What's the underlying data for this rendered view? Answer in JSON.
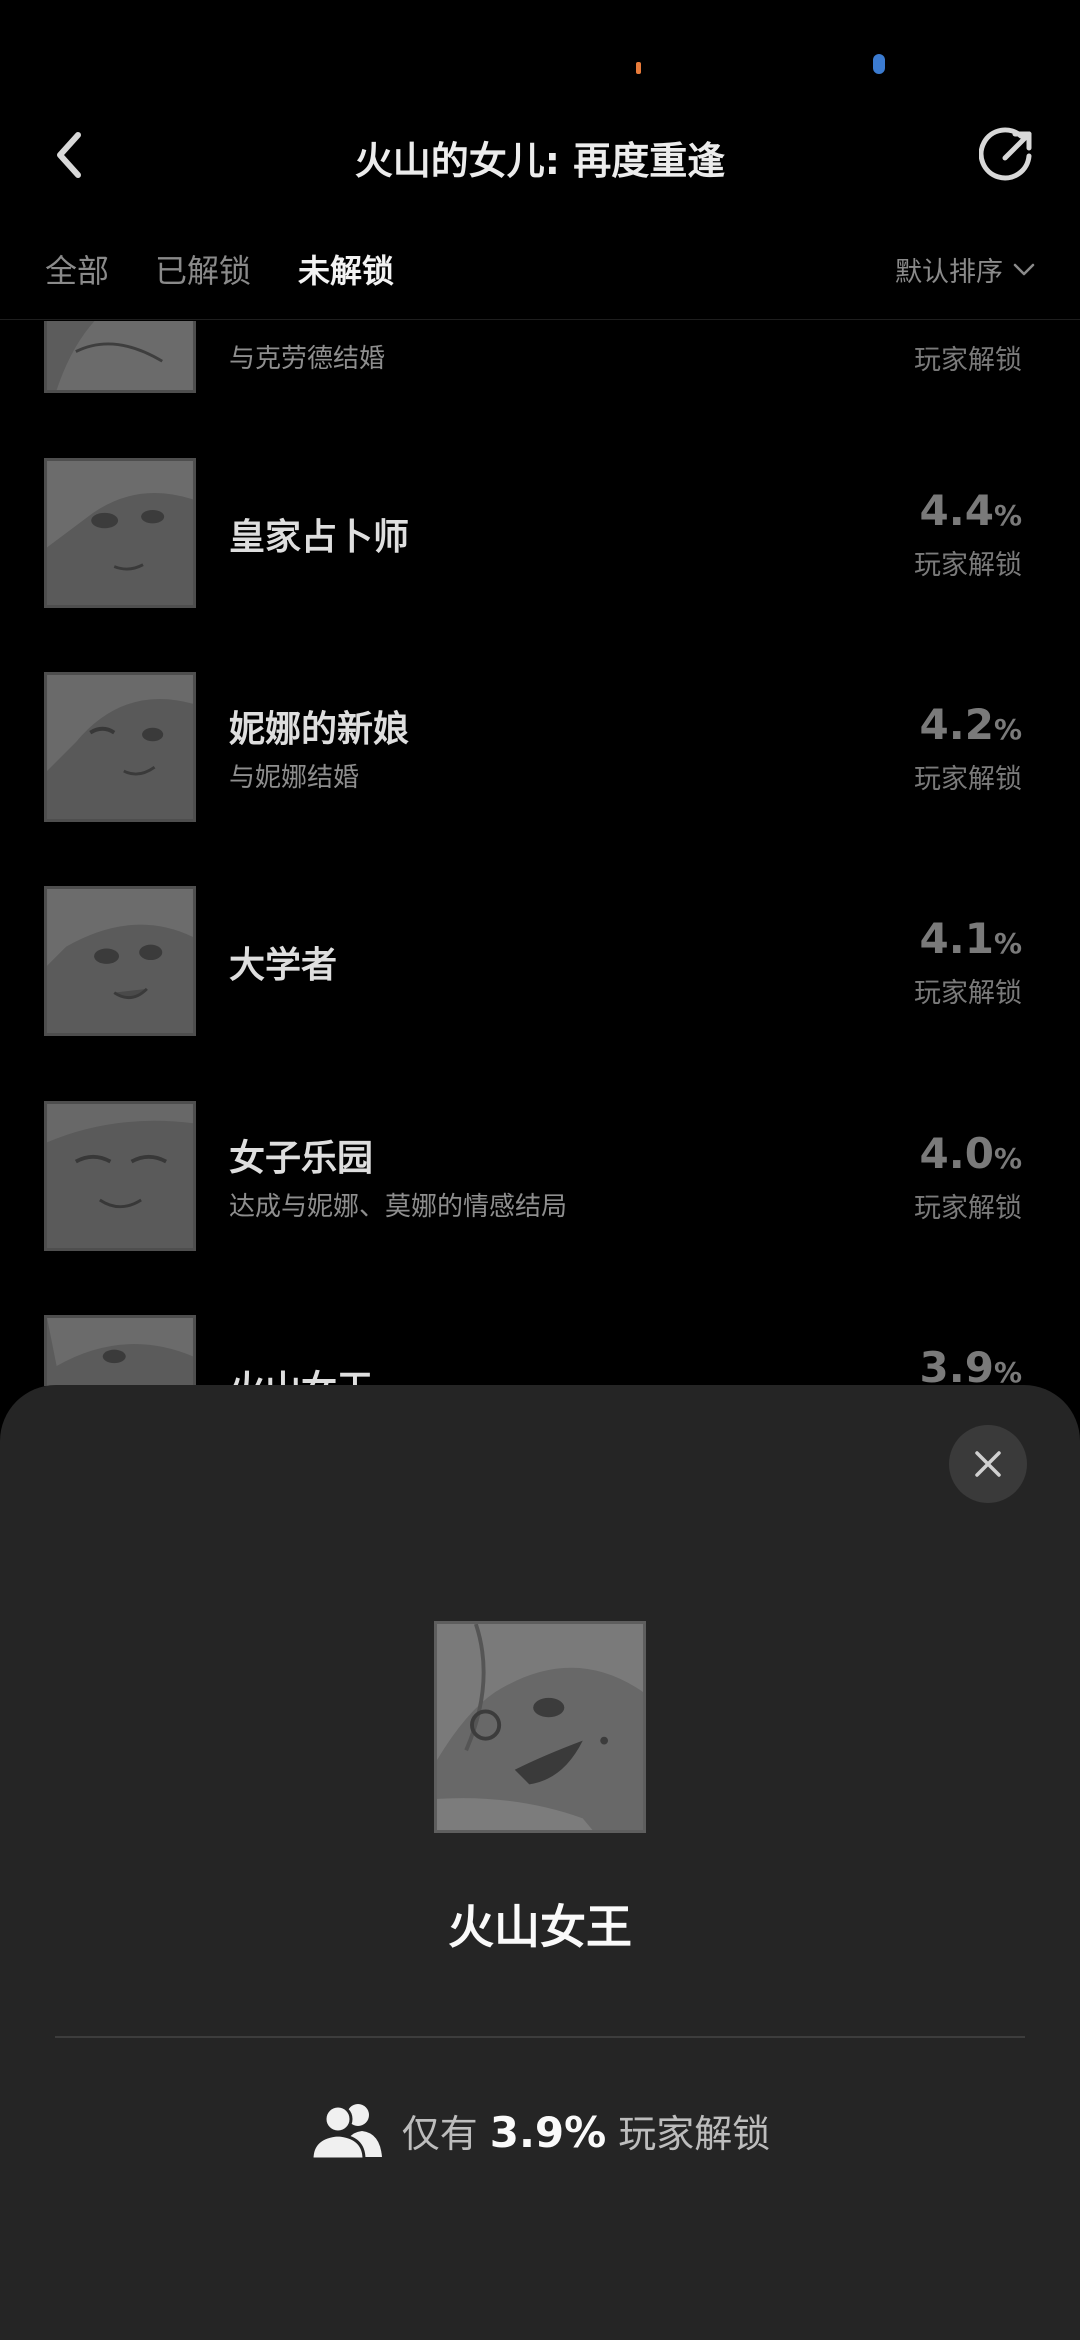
{
  "header": {
    "title": "火山的女儿: 再度重逢",
    "back_icon": "chevron-left-icon",
    "share_icon": "share-icon"
  },
  "tabs": [
    {
      "label": "全部",
      "active": false
    },
    {
      "label": "已解锁",
      "active": false
    },
    {
      "label": "未解锁",
      "active": true
    }
  ],
  "sort": {
    "label": "默认排序",
    "icon": "chevron-down-icon"
  },
  "achievements": [
    {
      "title": "",
      "subtitle": "与克劳德结婚",
      "percent": "",
      "unit": "",
      "unlock_label": "玩家解锁"
    },
    {
      "title": "皇家占卜师",
      "subtitle": "",
      "percent": "4.4",
      "unit": "%",
      "unlock_label": "玩家解锁"
    },
    {
      "title": "妮娜的新娘",
      "subtitle": "与妮娜结婚",
      "percent": "4.2",
      "unit": "%",
      "unlock_label": "玩家解锁"
    },
    {
      "title": "大学者",
      "subtitle": "",
      "percent": "4.1",
      "unit": "%",
      "unlock_label": "玩家解锁"
    },
    {
      "title": "女子乐园",
      "subtitle": "达成与妮娜、莫娜的情感结局",
      "percent": "4.0",
      "unit": "%",
      "unlock_label": "玩家解锁"
    },
    {
      "title": "火山女王",
      "subtitle": "",
      "percent": "3.9",
      "unit": "%",
      "unlock_label": ""
    }
  ],
  "sheet": {
    "title": "火山女王",
    "close_icon": "close-icon",
    "users_icon": "users-icon",
    "stat_prefix": "仅有",
    "stat_percent": "3.9%",
    "stat_suffix": "玩家解锁"
  },
  "colors": {
    "background": "#000000",
    "sheet": "#252525",
    "muted_text": "#8a8a8a",
    "percent_text": "#7a7a7a",
    "status_orange": "#e87b3a",
    "status_blue": "#3b7bd0"
  }
}
